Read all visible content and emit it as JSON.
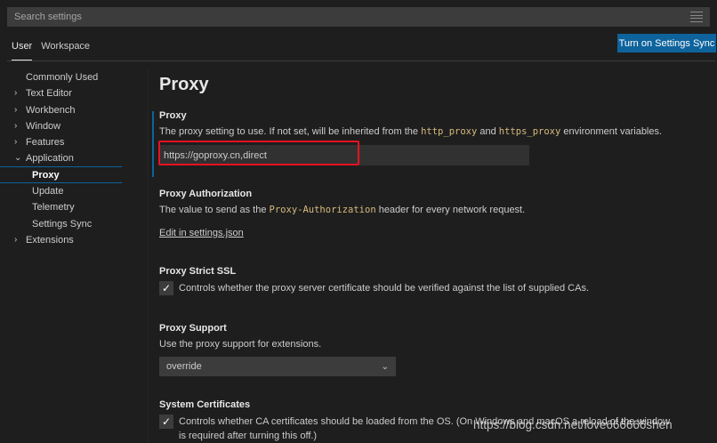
{
  "search": {
    "placeholder": "Search settings"
  },
  "tabs": [
    {
      "label": "User"
    },
    {
      "label": "Workspace"
    }
  ],
  "sync_button_label": "Turn on Settings Sync",
  "toc": {
    "items": [
      {
        "label": "Commonly Used"
      },
      {
        "label": "Text Editor",
        "chevron": "›"
      },
      {
        "label": "Workbench",
        "chevron": "›"
      },
      {
        "label": "Window",
        "chevron": "›"
      },
      {
        "label": "Features",
        "chevron": "›"
      },
      {
        "label": "Application",
        "chevron": "⌄"
      },
      {
        "label": "Proxy"
      },
      {
        "label": "Update"
      },
      {
        "label": "Telemetry"
      },
      {
        "label": "Settings Sync"
      },
      {
        "label": "Extensions",
        "chevron": "›"
      }
    ]
  },
  "page_title": "Proxy",
  "settings": {
    "proxy": {
      "title": "Proxy",
      "desc_before": "The proxy setting to use. If not set, will be inherited from the ",
      "code1": "http_proxy",
      "desc_middle": " and ",
      "code2": "https_proxy",
      "desc_after": " environment variables.",
      "value": "https://goproxy.cn,direct"
    },
    "proxy_authorization": {
      "title": "Proxy Authorization",
      "desc_before": "The value to send as the ",
      "code": "Proxy-Authorization",
      "desc_after": " header for every network request.",
      "link": "Edit in settings.json"
    },
    "proxy_strict_ssl": {
      "title": "Proxy Strict SSL",
      "checked": true,
      "check_glyph": "✓",
      "desc": "Controls whether the proxy server certificate should be verified against the list of supplied CAs."
    },
    "proxy_support": {
      "title": "Proxy Support",
      "desc": "Use the proxy support for extensions.",
      "selected": "override"
    },
    "system_certificates": {
      "title": "System Certificates",
      "checked": true,
      "check_glyph": "✓",
      "desc": "Controls whether CA certificates should be loaded from the OS. (On Windows and macOS a reload of the window is required after turning this off.)"
    }
  },
  "watermark": "https://blog.csdn.net/love666666shen",
  "colors": {
    "accent": "#0e639c",
    "highlight": "#e81123",
    "code": "#d7ba7d"
  },
  "icons": {
    "filter": "filter-icon",
    "chevron_right": "chevron-right-icon",
    "chevron_down": "chevron-down-icon",
    "check": "check-icon"
  }
}
